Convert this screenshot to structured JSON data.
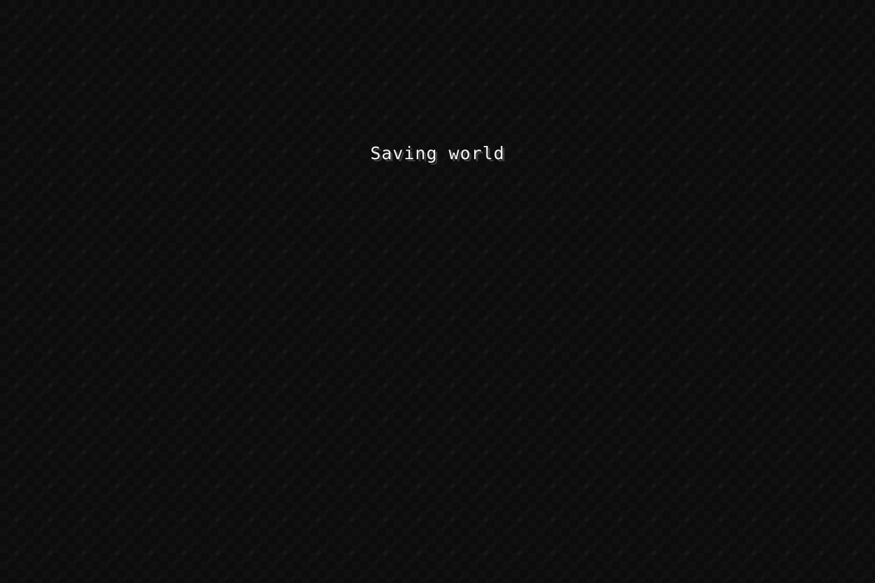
{
  "screen": {
    "status_text": "Saving world"
  },
  "colors": {
    "background": "#0c0c0c",
    "text": "#f2f2f2",
    "text_shadow": "#3e3e3e"
  }
}
